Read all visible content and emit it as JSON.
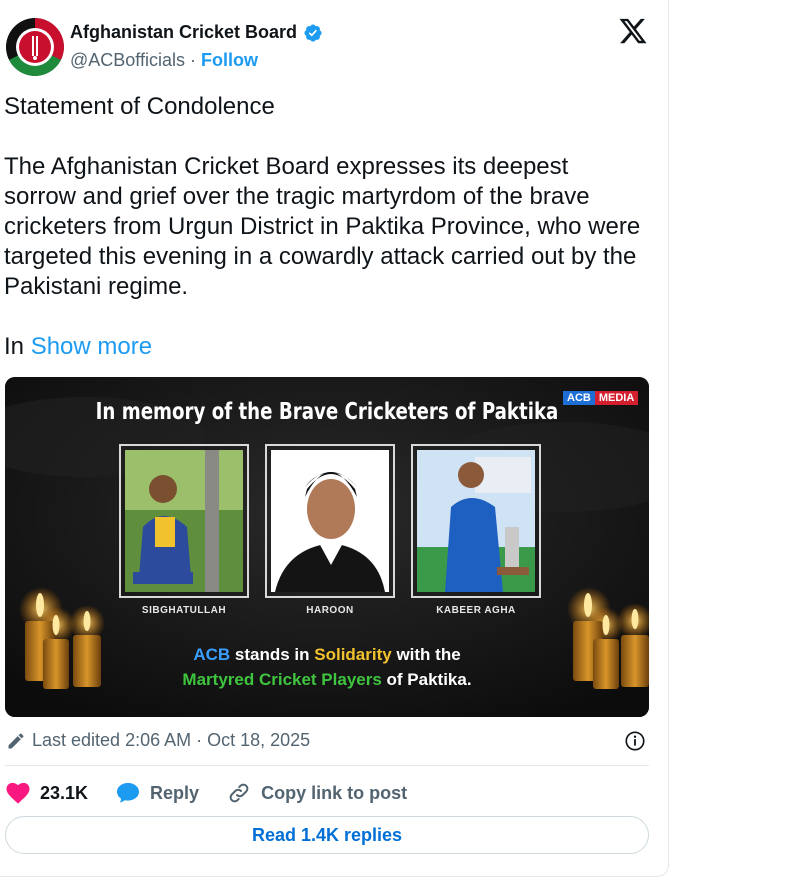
{
  "account": {
    "name": "Afghanistan Cricket Board",
    "handle": "@ACBofficials",
    "separator": "·",
    "follow_label": "Follow"
  },
  "post": {
    "heading": "Statement of Condolence",
    "body": "The Afghanistan Cricket Board expresses its deepest sorrow and grief over the tragic martyrdom of the brave cricketers from Urgun District in Paktika Province, who were targeted this evening in a cowardly attack carried out by the Pakistani regime.",
    "lead": "In",
    "show_more": "Show more"
  },
  "media": {
    "title": "In memory of the Brave Cricketers of Paktika",
    "badge_acb": "ACB",
    "badge_media": "MEDIA",
    "players": [
      "SIBGHATULLAH",
      "HAROON",
      "KABEER AGHA"
    ],
    "solidarity_line1": [
      "ACB",
      " stands in ",
      "Solidarity",
      " with the"
    ],
    "solidarity_line2": [
      "Martyred Cricket Players",
      " of Paktika."
    ]
  },
  "meta": {
    "edited": "Last edited 2:06 AM · Oct 18, 2025"
  },
  "actions": {
    "likes": "23.1K",
    "reply": "Reply",
    "copy_link": "Copy link to post"
  },
  "replies_button": "Read 1.4K replies",
  "colors": {
    "link": "#1d9bf0",
    "like": "#f91880",
    "replies_text": "#006fd6"
  }
}
